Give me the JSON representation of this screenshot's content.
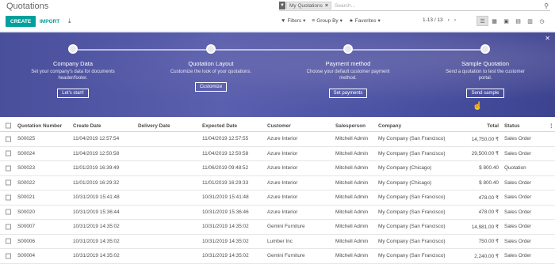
{
  "header": {
    "title": "Quotations",
    "create_label": "CREATE",
    "import_label": "IMPORT",
    "search": {
      "facet_label": "My Quotations",
      "facet_remove": "×",
      "placeholder": "Search..."
    },
    "filters_label": "Filters",
    "group_by_label": "Group By",
    "favorites_label": "Favorites",
    "pager": "1-13 / 13"
  },
  "banner": {
    "steps": [
      {
        "title": "Company Data",
        "desc": "Set your company's data for documents header/footer.",
        "button": "Let's start!"
      },
      {
        "title": "Quotation Layout",
        "desc": "Customize the look of your quotations.",
        "button": "Customize"
      },
      {
        "title": "Payment method",
        "desc": "Choose your default customer payment method.",
        "button": "Set payments"
      },
      {
        "title": "Sample Quotation",
        "desc": "Send a quotation to test the customer portal.",
        "button": "Send sample"
      }
    ]
  },
  "table": {
    "columns": [
      "Quotation Number",
      "Create Date",
      "Delivery Date",
      "Expected Date",
      "Customer",
      "Salesperson",
      "Company",
      "Total",
      "Status"
    ],
    "rows": [
      [
        "S00025",
        "11/04/2019 12:57:54",
        "",
        "11/04/2019 12:57:55",
        "Azure Interior",
        "Mitchell Admin",
        "My Company (San Francisco)",
        "14,750.00 ₹",
        "Sales Order"
      ],
      [
        "S00024",
        "11/04/2019 12:50:58",
        "",
        "11/04/2019 12:50:58",
        "Azure Interior",
        "Mitchell Admin",
        "My Company (San Francisco)",
        "29,500.00 ₹",
        "Sales Order"
      ],
      [
        "S00023",
        "11/01/2019 16:39:49",
        "",
        "11/06/2019 09:48:52",
        "Azure Interior",
        "Mitchell Admin",
        "My Company (Chicago)",
        "$ 800.40",
        "Quotation"
      ],
      [
        "S00022",
        "11/01/2019 16:29:32",
        "",
        "11/01/2019 16:29:33",
        "Azure Interior",
        "Mitchell Admin",
        "My Company (Chicago)",
        "$ 800.40",
        "Sales Order"
      ],
      [
        "S00021",
        "10/31/2019 15:41:48",
        "",
        "10/31/2019 15:41:48",
        "Azure Interior",
        "Mitchell Admin",
        "My Company (San Francisco)",
        "478.00 ₹",
        "Sales Order"
      ],
      [
        "S00020",
        "10/31/2019 15:36:44",
        "",
        "10/31/2019 15:36:46",
        "Azure Interior",
        "Mitchell Admin",
        "My Company (San Francisco)",
        "478.00 ₹",
        "Sales Order"
      ],
      [
        "S00007",
        "10/31/2019 14:35:02",
        "",
        "10/31/2019 14:35:02",
        "Gemini Furniture",
        "Mitchell Admin",
        "My Company (San Francisco)",
        "14,981.00 ₹",
        "Sales Order"
      ],
      [
        "S00006",
        "10/31/2019 14:35:02",
        "",
        "10/31/2019 14:35:02",
        "Lumber Inc",
        "Mitchell Admin",
        "My Company (San Francisco)",
        "750.00 ₹",
        "Sales Order"
      ],
      [
        "S00004",
        "10/31/2019 14:35:02",
        "",
        "10/31/2019 14:35:02",
        "Gemini Furniture",
        "Mitchell Admin",
        "My Company (San Francisco)",
        "2,240.00 ₹",
        "Sales Order"
      ]
    ]
  },
  "colors": {
    "accent": "#00a09d",
    "banner": "#4b52a3"
  }
}
